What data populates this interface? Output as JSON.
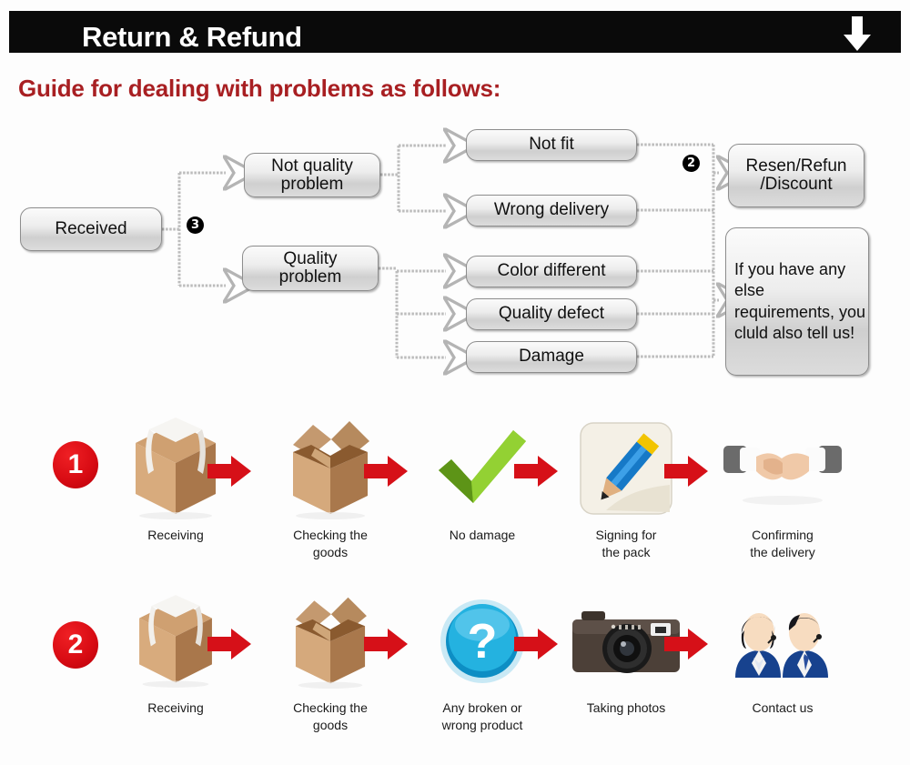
{
  "header": {
    "title": "Return & Refund",
    "arrow_icon": "down-arrow-icon",
    "bar_color": "#0a0a0a",
    "title_color": "#ffffff"
  },
  "guide": {
    "heading": "Guide for dealing with problems as follows:",
    "heading_color": "#a81f22"
  },
  "flowchart": {
    "markers": {
      "m3": "3",
      "m2": "2"
    },
    "nodes": {
      "received": "Received",
      "not_quality_problem": "Not quality\nproblem",
      "quality_problem": "Quality\nproblem",
      "not_fit": "Not fit",
      "wrong_delivery": "Wrong delivery",
      "color_different": "Color different",
      "quality_defect": "Quality defect",
      "damage": "Damage",
      "resend_refund_discount": "Resen/Refun\n/Discount",
      "if_you_have": "If you have any else requirements, you cluld also tell us!"
    }
  },
  "steps": [
    {
      "badge": "1",
      "items": [
        {
          "label": "Receiving",
          "icon": "sealed-box-icon"
        },
        {
          "label": "Checking the\ngoods",
          "icon": "open-box-icon"
        },
        {
          "label": "No damage",
          "icon": "green-check-icon"
        },
        {
          "label": "Signing for\nthe pack",
          "icon": "pencil-signing-icon"
        },
        {
          "label": "Confirming\nthe delivery",
          "icon": "handshake-icon"
        }
      ],
      "arrow_icon": "red-arrow-icon"
    },
    {
      "badge": "2",
      "items": [
        {
          "label": "Receiving",
          "icon": "sealed-box-icon"
        },
        {
          "label": "Checking the\ngoods",
          "icon": "open-box-icon"
        },
        {
          "label": "Any broken or\nwrong product",
          "icon": "blue-question-icon"
        },
        {
          "label": "Taking photos",
          "icon": "camera-icon"
        },
        {
          "label": "Contact us",
          "icon": "support-agents-icon"
        }
      ],
      "arrow_icon": "red-arrow-icon"
    }
  ],
  "colors": {
    "accent_red": "#d61018",
    "heading_red": "#a81f22",
    "node_border": "#8d8d8d",
    "connector": "#b9b9b9",
    "background": "#fdfdfd"
  }
}
